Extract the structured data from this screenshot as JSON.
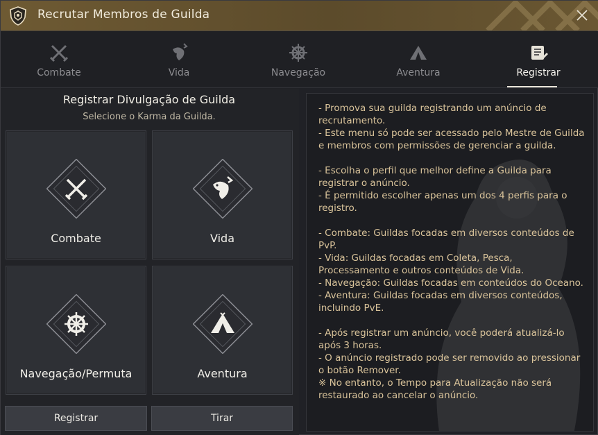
{
  "window": {
    "title": "Recrutar Membros de Guilda"
  },
  "tabs": [
    {
      "label": "Combate",
      "icon": "crossed-swords-icon",
      "active": false
    },
    {
      "label": "Vida",
      "icon": "fish-icon",
      "active": false
    },
    {
      "label": "Navegação",
      "icon": "ship-wheel-icon",
      "active": false
    },
    {
      "label": "Aventura",
      "icon": "tent-icon",
      "active": false
    },
    {
      "label": "Registrar",
      "icon": "scroll-icon",
      "active": true
    }
  ],
  "left": {
    "title": "Registrar Divulgação de Guilda",
    "subtitle": "Selecione o Karma da Guilda.",
    "cards": [
      {
        "label": "Combate",
        "icon": "crossed-swords-icon"
      },
      {
        "label": "Vida",
        "icon": "fish-icon"
      },
      {
        "label": "Navegação/Permuta",
        "icon": "ship-wheel-icon"
      },
      {
        "label": "Aventura",
        "icon": "tent-icon"
      }
    ],
    "register_button": "Registrar",
    "remove_button": "Tirar"
  },
  "info_text": "- Promova sua guilda registrando um anúncio de recrutamento.\n- Este menu só pode ser acessado pelo Mestre de Guilda e membros com permissões de gerenciar a guilda.\n\n- Escolha o perfil que melhor define a Guilda para registrar o anúncio.\n- É permitido escolher apenas um dos 4 perfis para o registro.\n\n- Combate: Guildas focadas em diversos conteúdos de PvP.\n- Vida: Guildas focadas em Coleta, Pesca, Processamento e outros conteúdos de Vida.\n- Navegação: Guildas focadas em conteúdos do Oceano.\n- Aventura: Guildas focadas em diversos conteúdos, incluindo PvE.\n\n- Após registrar um anúncio, você poderá atualizá-lo após 3 horas.\n- O anúncio registrado pode ser removido ao pressionar o botão Remover.\n※ No entanto, o Tempo para Atualização não será restaurado ao cancelar o anúncio.",
  "colors": {
    "accent_gold": "#d9c39a",
    "titlebar": "#6e5a33",
    "card_bg": "#2e3035"
  }
}
